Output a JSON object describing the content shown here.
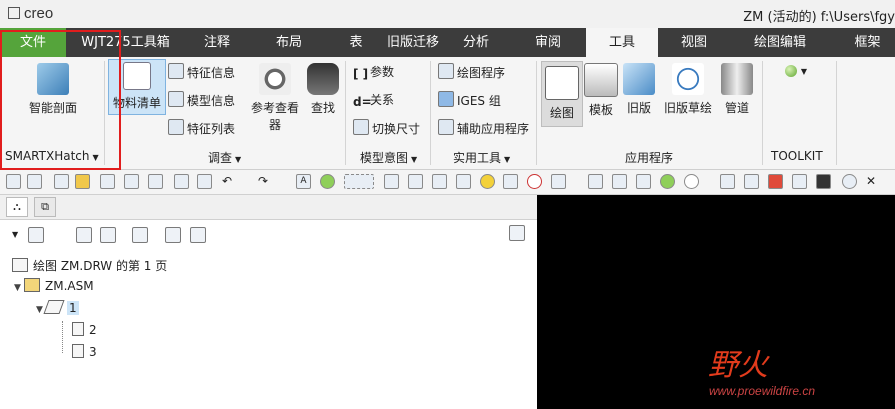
{
  "app": {
    "logo": "creo",
    "window_title": "ZM (活动的) f:\\Users\\fgy"
  },
  "tabs": [
    "文件",
    "WJT275工具箱",
    "注释",
    "布局",
    "表",
    "旧版迁移",
    "分析",
    "审阅",
    "工具",
    "视图",
    "绘图编辑",
    "框架"
  ],
  "active_tab": "工具",
  "ribbon": {
    "groups": [
      {
        "label": "SMARTXHatch",
        "dropdown": true
      },
      {
        "label": "调查",
        "dropdown": true
      },
      {
        "label": "模型意图",
        "dropdown": true
      },
      {
        "label": "实用工具",
        "dropdown": true
      },
      {
        "label": "应用程序",
        "dropdown": false
      },
      {
        "label": "TOOLKIT",
        "dropdown": false
      }
    ],
    "smart_section": "智能剖面",
    "bom": "物料清单",
    "feature_info": "特征信息",
    "model_info": "模型信息",
    "feature_list": "特征列表",
    "ref_viewer": "参考查看器",
    "find": "查找",
    "params": "参数",
    "relations": "关系",
    "switch_dims": "切换尺寸",
    "drawing_program": "绘图程序",
    "iges_group": "IGES 组",
    "aux_apps": "辅助应用程序",
    "drawing": "绘图",
    "template": "模板",
    "legacy": "旧版",
    "legacy_sketch": "旧版草绘",
    "piping": "管道"
  },
  "tree": {
    "root": "绘图 ZM.DRW 的第 1 页",
    "assembly": "ZM.ASM",
    "sheet": "1",
    "children": [
      "2",
      "3"
    ]
  },
  "watermark": {
    "text": "野火",
    "url": "www.proewildfire.cn"
  },
  "colors": {
    "file_tab": "#55a43b",
    "tab_bar": "#3c3c3c",
    "annotation": "#e11d1d",
    "watermark": "#e23b1c"
  }
}
